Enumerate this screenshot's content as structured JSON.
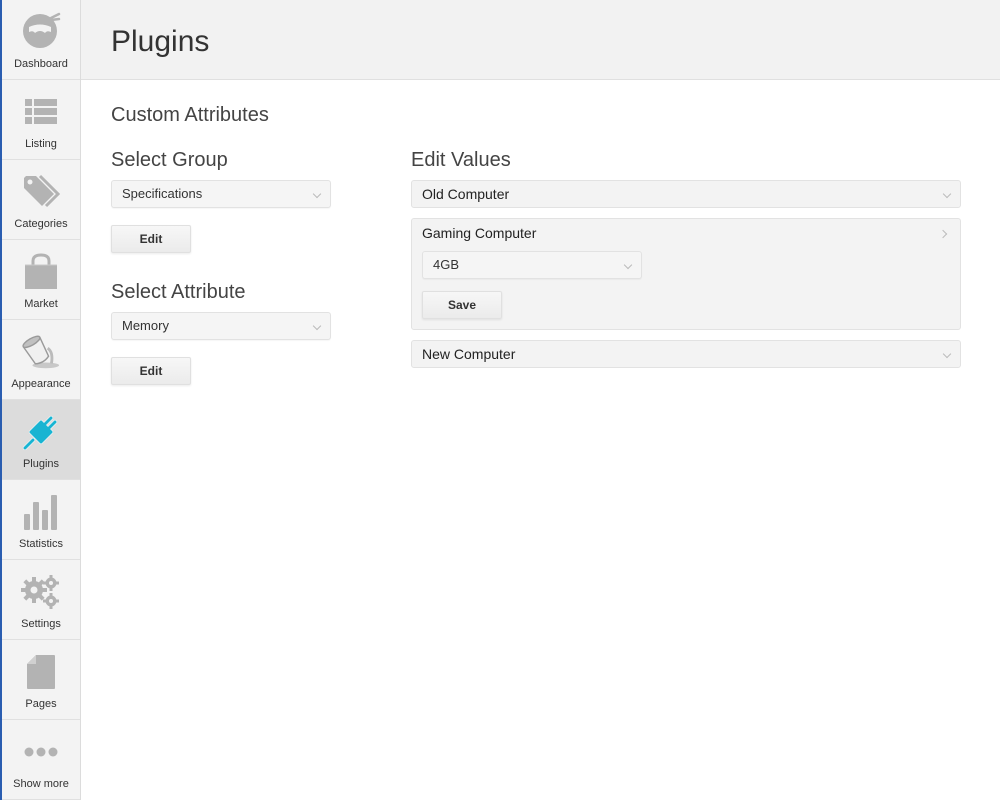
{
  "sidebar": {
    "accent_color": "#2a5db0",
    "active_icon_color": "#19b4d2",
    "items": [
      {
        "label": "Dashboard",
        "icon": "ninja-icon"
      },
      {
        "label": "Listing",
        "icon": "list-icon"
      },
      {
        "label": "Categories",
        "icon": "tag-icon"
      },
      {
        "label": "Market",
        "icon": "shopping-bag-icon"
      },
      {
        "label": "Appearance",
        "icon": "paint-bucket-icon"
      },
      {
        "label": "Plugins",
        "icon": "plug-icon",
        "active": true
      },
      {
        "label": "Statistics",
        "icon": "bar-chart-icon"
      },
      {
        "label": "Settings",
        "icon": "gears-icon"
      },
      {
        "label": "Pages",
        "icon": "page-icon"
      },
      {
        "label": "Show more",
        "icon": "ellipsis-icon"
      }
    ]
  },
  "header": {
    "title": "Plugins"
  },
  "main": {
    "section_title": "Custom Attributes",
    "select_group": {
      "title": "Select Group",
      "selected": "Specifications",
      "edit_label": "Edit"
    },
    "select_attribute": {
      "title": "Select Attribute",
      "selected": "Memory",
      "edit_label": "Edit"
    },
    "edit_values": {
      "title": "Edit Values",
      "items": [
        {
          "label": "Old Computer",
          "expanded": false
        },
        {
          "label": "Gaming Computer",
          "expanded": true,
          "selected_value": "4GB",
          "save_label": "Save"
        },
        {
          "label": "New Computer",
          "expanded": false
        }
      ]
    }
  }
}
